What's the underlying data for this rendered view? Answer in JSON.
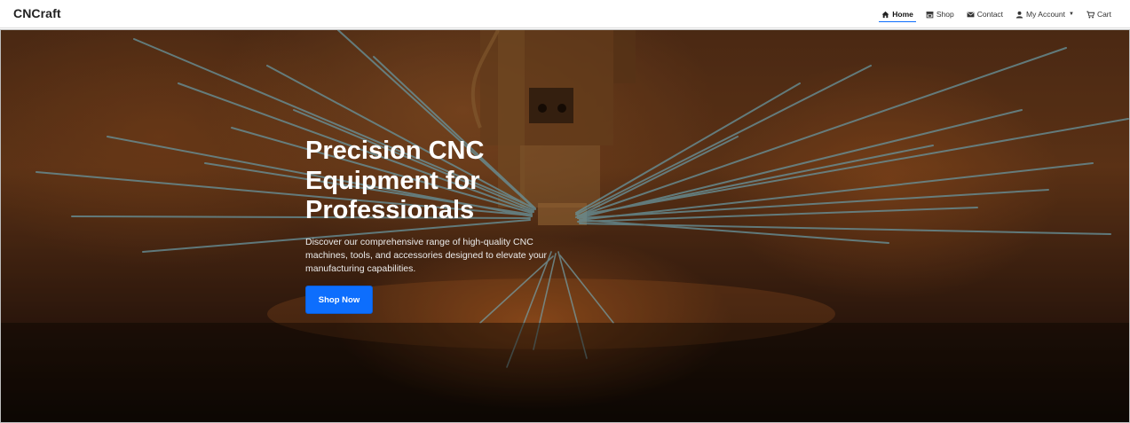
{
  "brand": "CNCraft",
  "nav": {
    "items": [
      {
        "label": "Home",
        "icon": "home-icon",
        "active": true
      },
      {
        "label": "Shop",
        "icon": "store-icon",
        "active": false
      },
      {
        "label": "Contact",
        "icon": "envelope-icon",
        "active": false
      },
      {
        "label": "My Account",
        "icon": "user-icon",
        "active": false,
        "dropdown": true
      },
      {
        "label": "Cart",
        "icon": "cart-icon",
        "active": false
      }
    ]
  },
  "hero": {
    "title_line1": "Precision CNC",
    "title_line2": "Equipment for",
    "title_line3": "Professionals",
    "description": "Discover our comprehensive range of high-quality CNC machines, tools, and accessories designed to elevate your manufacturing capabilities.",
    "button_label": "Shop Now"
  },
  "colors": {
    "accent": "#0d6efd",
    "navbar_bg": "#ffffff",
    "hero_text": "#ffffff"
  }
}
